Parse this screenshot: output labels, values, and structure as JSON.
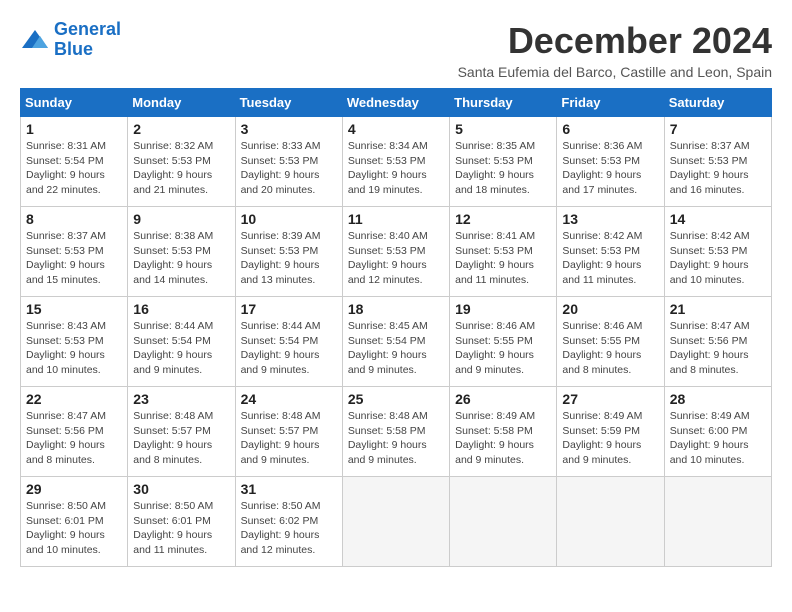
{
  "logo": {
    "line1": "General",
    "line2": "Blue"
  },
  "title": "December 2024",
  "subtitle": "Santa Eufemia del Barco, Castille and Leon, Spain",
  "days_header": [
    "Sunday",
    "Monday",
    "Tuesday",
    "Wednesday",
    "Thursday",
    "Friday",
    "Saturday"
  ],
  "weeks": [
    [
      {
        "day": "1",
        "info": "Sunrise: 8:31 AM\nSunset: 5:54 PM\nDaylight: 9 hours and 22 minutes."
      },
      {
        "day": "2",
        "info": "Sunrise: 8:32 AM\nSunset: 5:53 PM\nDaylight: 9 hours and 21 minutes."
      },
      {
        "day": "3",
        "info": "Sunrise: 8:33 AM\nSunset: 5:53 PM\nDaylight: 9 hours and 20 minutes."
      },
      {
        "day": "4",
        "info": "Sunrise: 8:34 AM\nSunset: 5:53 PM\nDaylight: 9 hours and 19 minutes."
      },
      {
        "day": "5",
        "info": "Sunrise: 8:35 AM\nSunset: 5:53 PM\nDaylight: 9 hours and 18 minutes."
      },
      {
        "day": "6",
        "info": "Sunrise: 8:36 AM\nSunset: 5:53 PM\nDaylight: 9 hours and 17 minutes."
      },
      {
        "day": "7",
        "info": "Sunrise: 8:37 AM\nSunset: 5:53 PM\nDaylight: 9 hours and 16 minutes."
      }
    ],
    [
      {
        "day": "8",
        "info": "Sunrise: 8:37 AM\nSunset: 5:53 PM\nDaylight: 9 hours and 15 minutes."
      },
      {
        "day": "9",
        "info": "Sunrise: 8:38 AM\nSunset: 5:53 PM\nDaylight: 9 hours and 14 minutes."
      },
      {
        "day": "10",
        "info": "Sunrise: 8:39 AM\nSunset: 5:53 PM\nDaylight: 9 hours and 13 minutes."
      },
      {
        "day": "11",
        "info": "Sunrise: 8:40 AM\nSunset: 5:53 PM\nDaylight: 9 hours and 12 minutes."
      },
      {
        "day": "12",
        "info": "Sunrise: 8:41 AM\nSunset: 5:53 PM\nDaylight: 9 hours and 11 minutes."
      },
      {
        "day": "13",
        "info": "Sunrise: 8:42 AM\nSunset: 5:53 PM\nDaylight: 9 hours and 11 minutes."
      },
      {
        "day": "14",
        "info": "Sunrise: 8:42 AM\nSunset: 5:53 PM\nDaylight: 9 hours and 10 minutes."
      }
    ],
    [
      {
        "day": "15",
        "info": "Sunrise: 8:43 AM\nSunset: 5:53 PM\nDaylight: 9 hours and 10 minutes."
      },
      {
        "day": "16",
        "info": "Sunrise: 8:44 AM\nSunset: 5:54 PM\nDaylight: 9 hours and 9 minutes."
      },
      {
        "day": "17",
        "info": "Sunrise: 8:44 AM\nSunset: 5:54 PM\nDaylight: 9 hours and 9 minutes."
      },
      {
        "day": "18",
        "info": "Sunrise: 8:45 AM\nSunset: 5:54 PM\nDaylight: 9 hours and 9 minutes."
      },
      {
        "day": "19",
        "info": "Sunrise: 8:46 AM\nSunset: 5:55 PM\nDaylight: 9 hours and 9 minutes."
      },
      {
        "day": "20",
        "info": "Sunrise: 8:46 AM\nSunset: 5:55 PM\nDaylight: 9 hours and 8 minutes."
      },
      {
        "day": "21",
        "info": "Sunrise: 8:47 AM\nSunset: 5:56 PM\nDaylight: 9 hours and 8 minutes."
      }
    ],
    [
      {
        "day": "22",
        "info": "Sunrise: 8:47 AM\nSunset: 5:56 PM\nDaylight: 9 hours and 8 minutes."
      },
      {
        "day": "23",
        "info": "Sunrise: 8:48 AM\nSunset: 5:57 PM\nDaylight: 9 hours and 8 minutes."
      },
      {
        "day": "24",
        "info": "Sunrise: 8:48 AM\nSunset: 5:57 PM\nDaylight: 9 hours and 9 minutes."
      },
      {
        "day": "25",
        "info": "Sunrise: 8:48 AM\nSunset: 5:58 PM\nDaylight: 9 hours and 9 minutes."
      },
      {
        "day": "26",
        "info": "Sunrise: 8:49 AM\nSunset: 5:58 PM\nDaylight: 9 hours and 9 minutes."
      },
      {
        "day": "27",
        "info": "Sunrise: 8:49 AM\nSunset: 5:59 PM\nDaylight: 9 hours and 9 minutes."
      },
      {
        "day": "28",
        "info": "Sunrise: 8:49 AM\nSunset: 6:00 PM\nDaylight: 9 hours and 10 minutes."
      }
    ],
    [
      {
        "day": "29",
        "info": "Sunrise: 8:50 AM\nSunset: 6:01 PM\nDaylight: 9 hours and 10 minutes."
      },
      {
        "day": "30",
        "info": "Sunrise: 8:50 AM\nSunset: 6:01 PM\nDaylight: 9 hours and 11 minutes."
      },
      {
        "day": "31",
        "info": "Sunrise: 8:50 AM\nSunset: 6:02 PM\nDaylight: 9 hours and 12 minutes."
      },
      null,
      null,
      null,
      null
    ]
  ]
}
